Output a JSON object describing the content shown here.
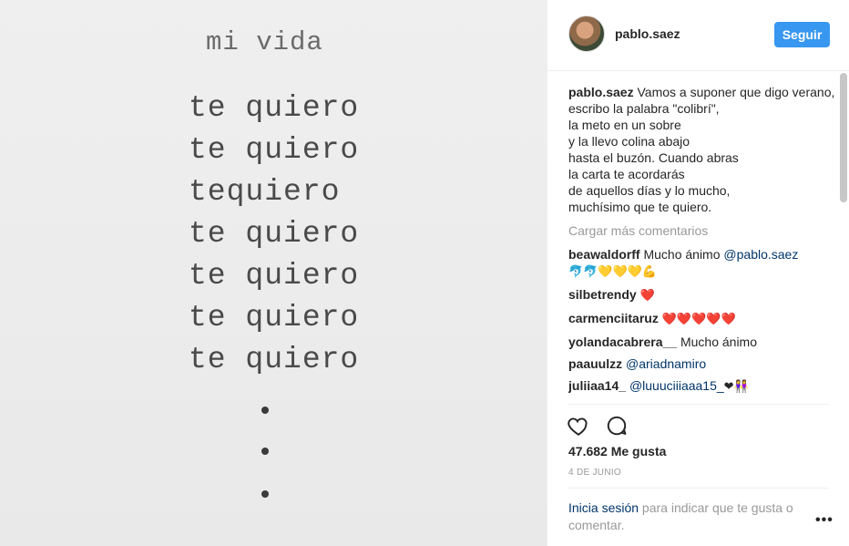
{
  "photo": {
    "title": "mi vida",
    "lines": [
      "te quiero",
      "te quiero",
      "tequiero",
      "te quiero",
      "te quiero",
      "te quiero",
      "te quiero"
    ]
  },
  "header": {
    "username": "pablo.saez",
    "follow_label": "Seguir"
  },
  "caption": {
    "username": "pablo.saez",
    "text": "Vamos a suponer que digo verano,\nescribo la palabra \"colibrí\",\nla meto en un sobre\ny la llevo colina abajo\nhasta el buzón. Cuando abras\nla carta te acordarás\nde aquellos días y lo mucho,\nmuchísimo que te quiero."
  },
  "load_more": "Cargar más comentarios",
  "comments": [
    {
      "user": "beawaldorff",
      "text": "Mucho ánimo",
      "mention": "@pablo.saez",
      "emoji": "🐬🐬💛💛💛💪"
    },
    {
      "user": "silbetrendy",
      "text": "",
      "mention": "",
      "emoji": "❤️"
    },
    {
      "user": "carmenciitaruz",
      "text": "",
      "mention": "",
      "emoji": "❤️❤️❤️❤️❤️"
    },
    {
      "user": "yolandacabrera__",
      "text": "Mucho ánimo",
      "mention": "",
      "emoji": ""
    },
    {
      "user": "paauulzz",
      "text": "",
      "mention": "@ariadnamiro",
      "emoji": ""
    },
    {
      "user": "juliiaa14_",
      "text": "",
      "mention": "@luuuciiiaaa15_",
      "emoji": "❤👭"
    }
  ],
  "actions": {
    "like_icon": "heart-outline-icon",
    "comment_icon": "speech-bubble-icon"
  },
  "likes": "47.682 Me gusta",
  "date": "4 DE JUNIO",
  "login": {
    "link": "Inicia sesión",
    "rest": " para indicar que te gusta o comentar."
  },
  "more_options": "•••",
  "colors": {
    "accent": "#3897f0",
    "link": "#003569",
    "muted": "#999999"
  }
}
